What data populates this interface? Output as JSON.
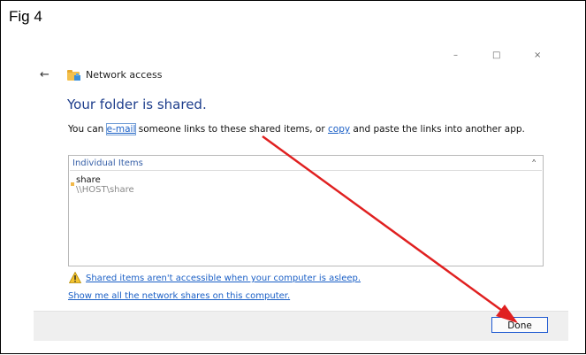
{
  "figure_label": "Fig 4",
  "window": {
    "title": "Network access",
    "controls": {
      "minimize": "–",
      "maximize": "□",
      "close": "×"
    },
    "back": "←"
  },
  "heading": "Your folder is shared.",
  "description": {
    "prefix": "You can ",
    "email_link": "e-mail",
    "middle": " someone links to these shared items, or ",
    "copy_link": "copy",
    "suffix": " and paste the links into another app."
  },
  "items": {
    "header": "Individual Items",
    "collapse_glyph": "^",
    "entries": [
      {
        "name": "share",
        "path": "\\\\HOST\\share"
      }
    ]
  },
  "warning_link": "Shared items aren't accessible when your computer is asleep.",
  "show_link": "Show me all the network shares on this computer.",
  "done_label": "Done",
  "annotation": {
    "arrow_color": "#e02020"
  },
  "icons": {
    "back": "arrow-left-icon",
    "folder": "network-folder-icon",
    "warning": "warning-icon"
  }
}
